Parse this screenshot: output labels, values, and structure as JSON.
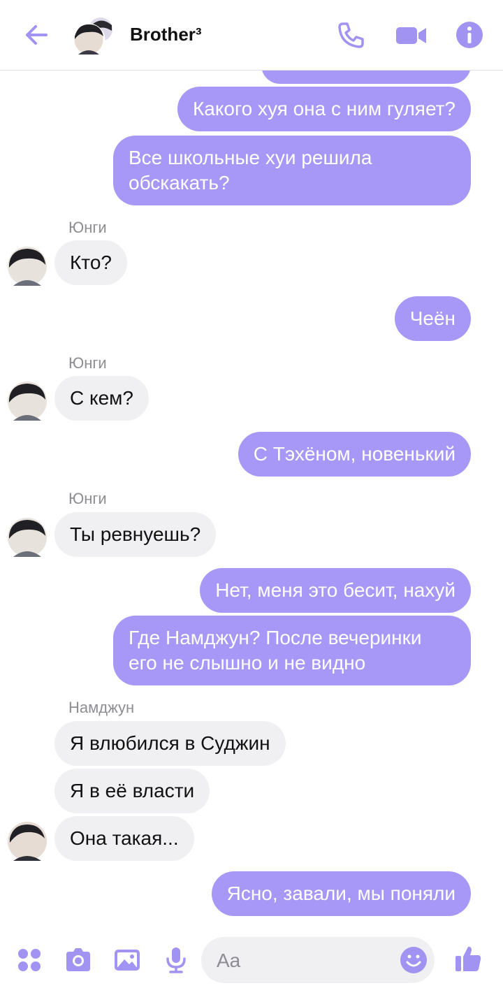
{
  "header": {
    "title": "Brother³"
  },
  "colors": {
    "accent": "#a093f2",
    "bubble_out": "#a797f6",
    "bubble_in": "#f0f0f3"
  },
  "icons": [
    "back-arrow-icon",
    "phone-icon",
    "video-camera-icon",
    "info-icon",
    "apps-icon",
    "camera-icon",
    "image-icon",
    "microphone-icon",
    "emoji-icon",
    "thumbs-up-icon"
  ],
  "messages": [
    {
      "text": "Какого хуя она с ним гуляет?"
    },
    {
      "text": "Все школьные хуи решила обскакать?"
    },
    {
      "sender": "Юнги",
      "text": "Кто?"
    },
    {
      "text": "Чеён"
    },
    {
      "sender": "Юнги",
      "text": "С кем?"
    },
    {
      "text": "С Тэхёном, новенький"
    },
    {
      "sender": "Юнги",
      "text": "Ты ревнуешь?"
    },
    {
      "text": "Нет, меня это бесит, нахуй"
    },
    {
      "text": "Где Намджун? После вечеринки его не слышно и не видно"
    },
    {
      "sender": "Намджун",
      "text": "Я влюбился в Суджин"
    },
    {
      "text": "Я в её власти"
    },
    {
      "text": "Она такая..."
    },
    {
      "text": "Ясно, завали, мы поняли"
    }
  ],
  "composer": {
    "placeholder": "Aa"
  }
}
